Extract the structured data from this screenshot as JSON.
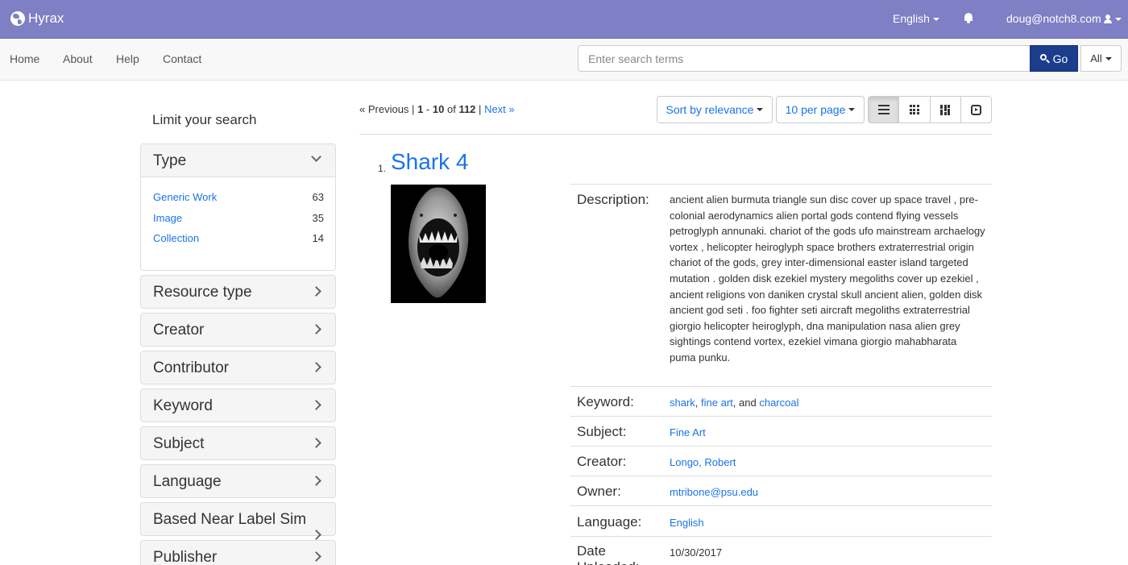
{
  "topbar": {
    "brand": "Hyrax",
    "language": "English",
    "user": "doug@notch8.com"
  },
  "nav": {
    "links": [
      "Home",
      "About",
      "Help",
      "Contact"
    ],
    "search_placeholder": "Enter search terms",
    "go_label": "Go",
    "scope_label": "All"
  },
  "sidebar": {
    "title": "Limit your search",
    "type_facet": {
      "title": "Type",
      "items": [
        {
          "label": "Generic Work",
          "count": "63"
        },
        {
          "label": "Image",
          "count": "35"
        },
        {
          "label": "Collection",
          "count": "14"
        }
      ]
    },
    "facets": [
      "Resource type",
      "Creator",
      "Contributor",
      "Keyword",
      "Subject",
      "Language",
      "Based Near Label Sim",
      "Publisher"
    ]
  },
  "results": {
    "pager": {
      "previous": "« Previous",
      "range_start": "1",
      "range_end": "10",
      "of": "of",
      "total": "112",
      "next": "Next »"
    },
    "sort_label": "Sort by relevance",
    "per_page_label": "10 per page",
    "view_modes": [
      "list-view",
      "gallery-view",
      "masonry-view",
      "slideshow-view"
    ],
    "document": {
      "number": "1.",
      "title": "Shark 4",
      "thumbnail_alt": "shark",
      "fields": {
        "description_label": "Description:",
        "description": "ancient alien burmuta triangle sun disc cover up space travel , pre-colonial aerodynamics alien portal gods contend flying vessels petroglyph annunaki. chariot of the gods ufo mainstream archaelogy vortex , helicopter heiroglyph space brothers extraterrestrial origin chariot of the gods, grey inter-dimensional easter island targeted mutation . golden disk ezekiel mystery megoliths cover up ezekiel , ancient religions von daniken crystal skull ancient alien, golden disk ancient god seti . foo fighter seti aircraft megoliths extraterrestrial giorgio helicopter heiroglyph, dna manipulation nasa alien grey sightings contend vortex, ezekiel vimana giorgio mahabharata puma punku.",
        "keyword_label": "Keyword:",
        "keywords": [
          "shark",
          "fine art",
          "charcoal"
        ],
        "keyword_and": "and",
        "subject_label": "Subject:",
        "subject": "Fine Art",
        "creator_label": "Creator:",
        "creator": "Longo, Robert",
        "owner_label": "Owner:",
        "owner": "mtribone@psu.edu",
        "language_label": "Language:",
        "language": "English",
        "date_label": "Date Uploaded:",
        "date": "10/30/2017"
      }
    }
  },
  "colors": {
    "topbar": "#7e7fc4",
    "link": "#1a73e8",
    "go_button": "#1c3c8c"
  }
}
